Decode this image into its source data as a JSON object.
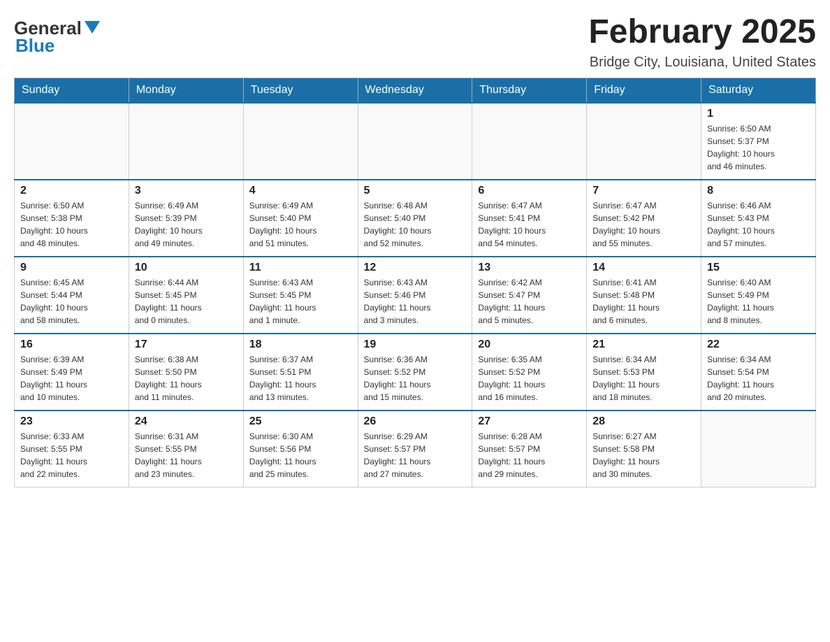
{
  "header": {
    "logo_general": "General",
    "logo_blue": "Blue",
    "month_title": "February 2025",
    "location": "Bridge City, Louisiana, United States"
  },
  "weekdays": [
    "Sunday",
    "Monday",
    "Tuesday",
    "Wednesday",
    "Thursday",
    "Friday",
    "Saturday"
  ],
  "weeks": [
    [
      {
        "day": "",
        "info": ""
      },
      {
        "day": "",
        "info": ""
      },
      {
        "day": "",
        "info": ""
      },
      {
        "day": "",
        "info": ""
      },
      {
        "day": "",
        "info": ""
      },
      {
        "day": "",
        "info": ""
      },
      {
        "day": "1",
        "info": "Sunrise: 6:50 AM\nSunset: 5:37 PM\nDaylight: 10 hours\nand 46 minutes."
      }
    ],
    [
      {
        "day": "2",
        "info": "Sunrise: 6:50 AM\nSunset: 5:38 PM\nDaylight: 10 hours\nand 48 minutes."
      },
      {
        "day": "3",
        "info": "Sunrise: 6:49 AM\nSunset: 5:39 PM\nDaylight: 10 hours\nand 49 minutes."
      },
      {
        "day": "4",
        "info": "Sunrise: 6:49 AM\nSunset: 5:40 PM\nDaylight: 10 hours\nand 51 minutes."
      },
      {
        "day": "5",
        "info": "Sunrise: 6:48 AM\nSunset: 5:40 PM\nDaylight: 10 hours\nand 52 minutes."
      },
      {
        "day": "6",
        "info": "Sunrise: 6:47 AM\nSunset: 5:41 PM\nDaylight: 10 hours\nand 54 minutes."
      },
      {
        "day": "7",
        "info": "Sunrise: 6:47 AM\nSunset: 5:42 PM\nDaylight: 10 hours\nand 55 minutes."
      },
      {
        "day": "8",
        "info": "Sunrise: 6:46 AM\nSunset: 5:43 PM\nDaylight: 10 hours\nand 57 minutes."
      }
    ],
    [
      {
        "day": "9",
        "info": "Sunrise: 6:45 AM\nSunset: 5:44 PM\nDaylight: 10 hours\nand 58 minutes."
      },
      {
        "day": "10",
        "info": "Sunrise: 6:44 AM\nSunset: 5:45 PM\nDaylight: 11 hours\nand 0 minutes."
      },
      {
        "day": "11",
        "info": "Sunrise: 6:43 AM\nSunset: 5:45 PM\nDaylight: 11 hours\nand 1 minute."
      },
      {
        "day": "12",
        "info": "Sunrise: 6:43 AM\nSunset: 5:46 PM\nDaylight: 11 hours\nand 3 minutes."
      },
      {
        "day": "13",
        "info": "Sunrise: 6:42 AM\nSunset: 5:47 PM\nDaylight: 11 hours\nand 5 minutes."
      },
      {
        "day": "14",
        "info": "Sunrise: 6:41 AM\nSunset: 5:48 PM\nDaylight: 11 hours\nand 6 minutes."
      },
      {
        "day": "15",
        "info": "Sunrise: 6:40 AM\nSunset: 5:49 PM\nDaylight: 11 hours\nand 8 minutes."
      }
    ],
    [
      {
        "day": "16",
        "info": "Sunrise: 6:39 AM\nSunset: 5:49 PM\nDaylight: 11 hours\nand 10 minutes."
      },
      {
        "day": "17",
        "info": "Sunrise: 6:38 AM\nSunset: 5:50 PM\nDaylight: 11 hours\nand 11 minutes."
      },
      {
        "day": "18",
        "info": "Sunrise: 6:37 AM\nSunset: 5:51 PM\nDaylight: 11 hours\nand 13 minutes."
      },
      {
        "day": "19",
        "info": "Sunrise: 6:36 AM\nSunset: 5:52 PM\nDaylight: 11 hours\nand 15 minutes."
      },
      {
        "day": "20",
        "info": "Sunrise: 6:35 AM\nSunset: 5:52 PM\nDaylight: 11 hours\nand 16 minutes."
      },
      {
        "day": "21",
        "info": "Sunrise: 6:34 AM\nSunset: 5:53 PM\nDaylight: 11 hours\nand 18 minutes."
      },
      {
        "day": "22",
        "info": "Sunrise: 6:34 AM\nSunset: 5:54 PM\nDaylight: 11 hours\nand 20 minutes."
      }
    ],
    [
      {
        "day": "23",
        "info": "Sunrise: 6:33 AM\nSunset: 5:55 PM\nDaylight: 11 hours\nand 22 minutes."
      },
      {
        "day": "24",
        "info": "Sunrise: 6:31 AM\nSunset: 5:55 PM\nDaylight: 11 hours\nand 23 minutes."
      },
      {
        "day": "25",
        "info": "Sunrise: 6:30 AM\nSunset: 5:56 PM\nDaylight: 11 hours\nand 25 minutes."
      },
      {
        "day": "26",
        "info": "Sunrise: 6:29 AM\nSunset: 5:57 PM\nDaylight: 11 hours\nand 27 minutes."
      },
      {
        "day": "27",
        "info": "Sunrise: 6:28 AM\nSunset: 5:57 PM\nDaylight: 11 hours\nand 29 minutes."
      },
      {
        "day": "28",
        "info": "Sunrise: 6:27 AM\nSunset: 5:58 PM\nDaylight: 11 hours\nand 30 minutes."
      },
      {
        "day": "",
        "info": ""
      }
    ]
  ]
}
